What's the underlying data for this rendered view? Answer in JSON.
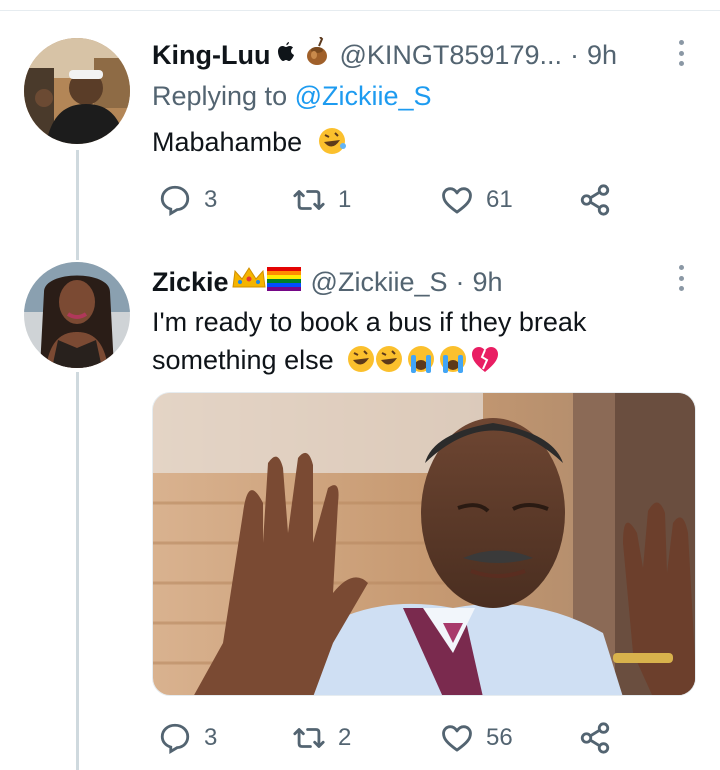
{
  "tweets": [
    {
      "name": "King-Luu",
      "name_emojis": "",
      "handle": "@KINGT859179...",
      "dot": "·",
      "time": "9h",
      "replying_prefix": "Replying to ",
      "replying_to": "@Zickiie_S",
      "text": "Mabahambe",
      "text_emoji": "🤣",
      "replies": "3",
      "retweets": "1",
      "likes": "61"
    },
    {
      "name": "Zickie",
      "name_emojis": "👑🏳️‍🌈",
      "handle": "@Zickiie_S",
      "dot": "·",
      "time": "9h",
      "text_line1": "I'm ready to book a bus if they break",
      "text_line2": "something else",
      "text_emoji": "🤣🤣😭😭💔",
      "replies": "3",
      "retweets": "2",
      "likes": "56"
    }
  ],
  "icons": {
    "reply": "reply-icon",
    "retweet": "retweet-icon",
    "like": "like-icon",
    "share": "share-icon",
    "more": "more-icon"
  },
  "colors": {
    "link": "#1d9bf0",
    "secondary_text": "#536471",
    "icon": "#536471",
    "thread_line": "#cfd9de"
  }
}
